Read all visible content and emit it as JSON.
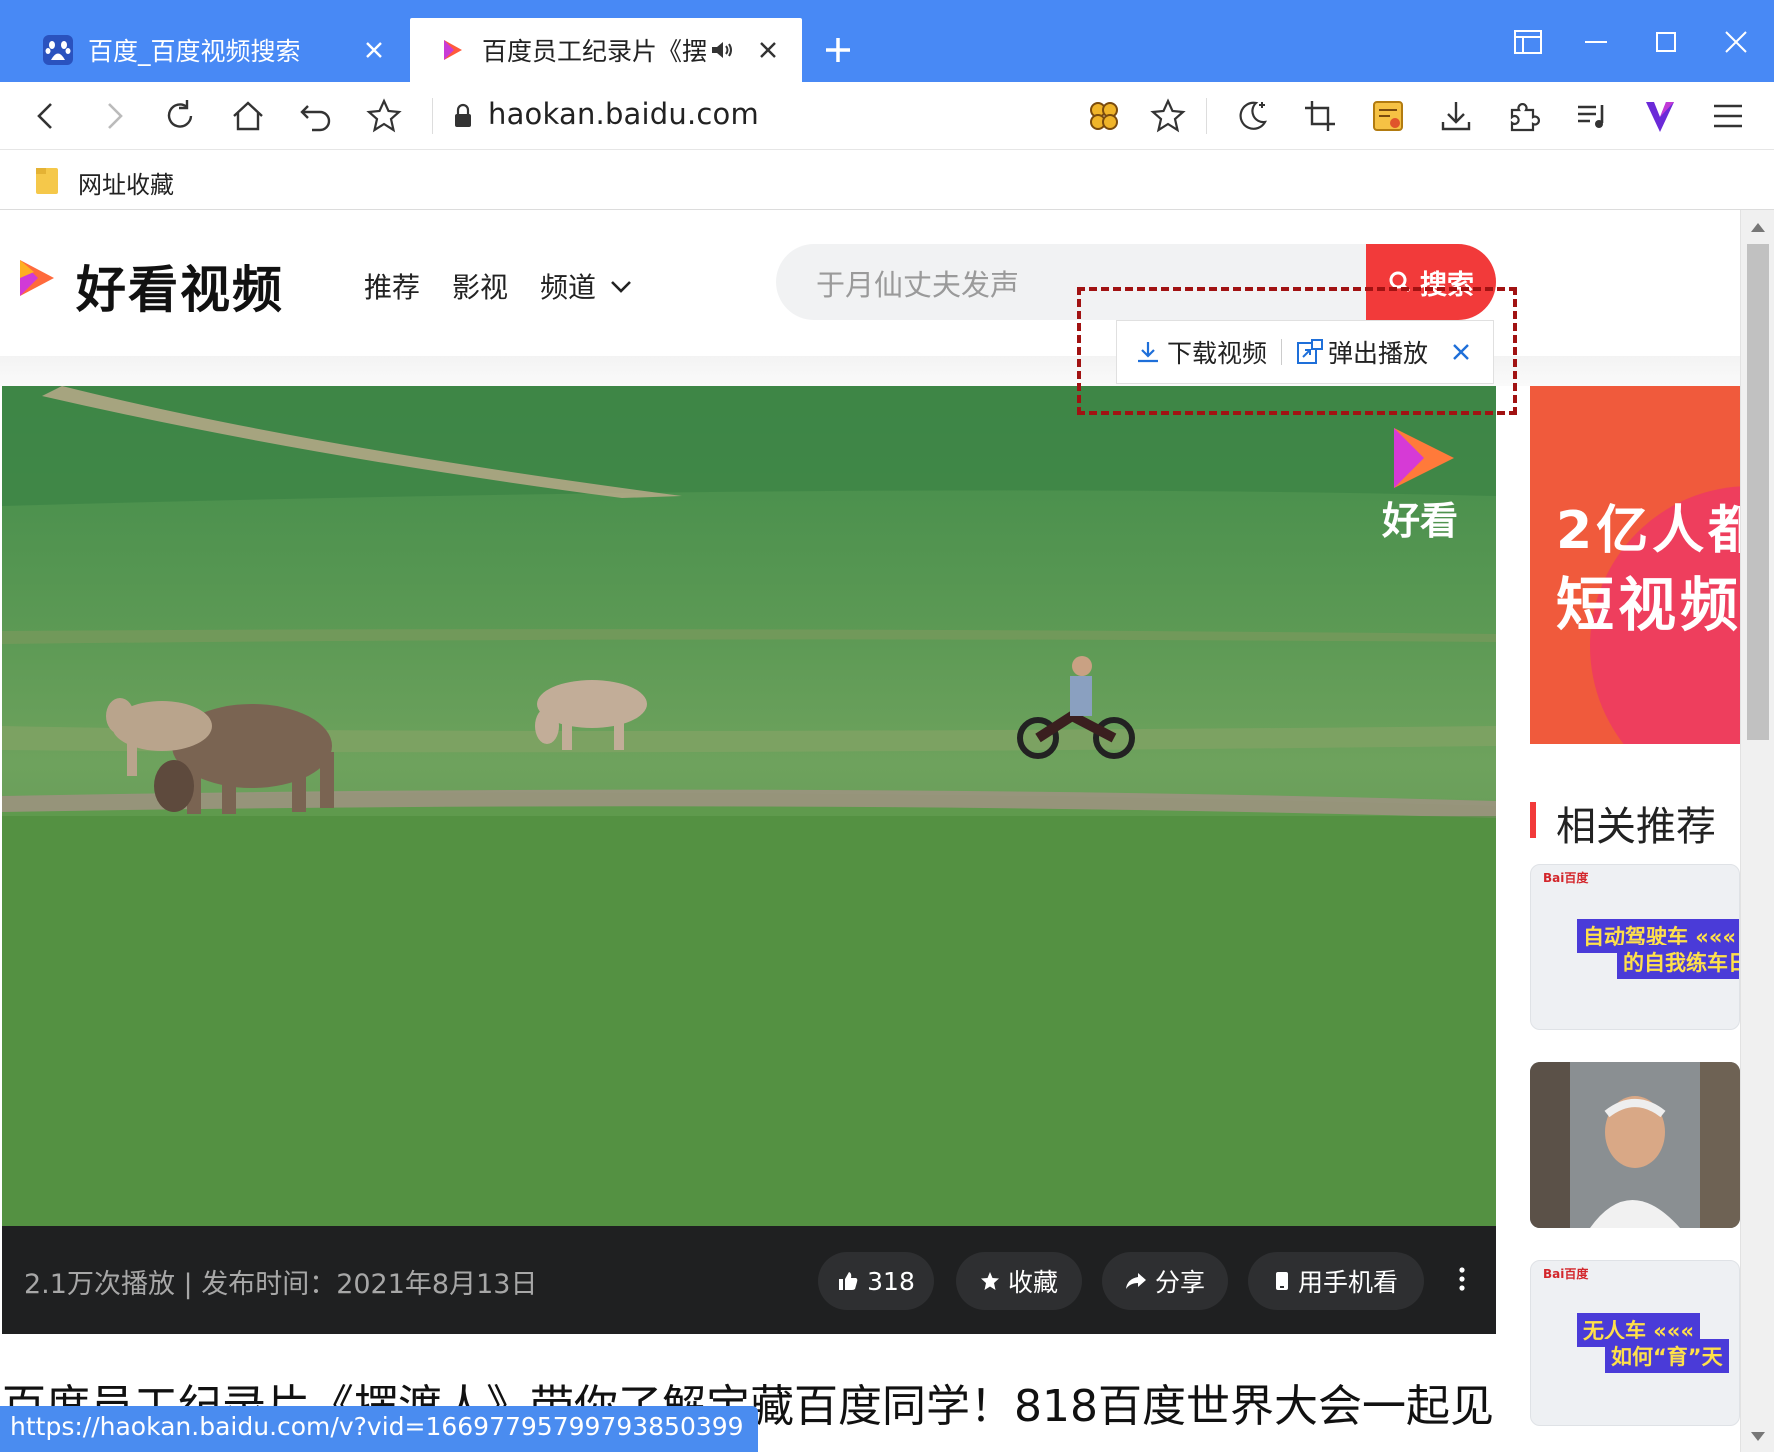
{
  "browser": {
    "tabs": [
      {
        "title": "百度_百度视频搜索",
        "active": false
      },
      {
        "title": "百度员工纪录片《摆",
        "active": true
      }
    ],
    "address": "haokan.baidu.com",
    "bookmarks": [
      {
        "label": "网址收藏"
      }
    ],
    "status_url": "https://haokan.baidu.com/v?vid=16697795799793850399"
  },
  "site": {
    "logo_text": "好看视频",
    "nav": [
      "推荐",
      "影视",
      "频道"
    ],
    "search": {
      "placeholder": "于月仙丈夫发声",
      "button": "搜索"
    }
  },
  "video_popover": {
    "download": "下载视频",
    "popup": "弹出播放"
  },
  "video": {
    "watermark": "好看",
    "views": "2.1万次播放 | 发布时间：2021年8月13日",
    "likes": "318",
    "favorite": "收藏",
    "share": "分享",
    "mobile": "用手机看",
    "title": "百度员工纪录片《摆渡人》带你了解宝藏百度同学！818百度世界大会一起见"
  },
  "sidebar": {
    "ad_line1": "2亿人都",
    "ad_line2": "短视频",
    "related_title": "相关推荐",
    "thumb_labels": [
      "自动驾驶车 «««",
      "的自我练车日",
      "无人车 «««",
      "如何“育”天"
    ]
  },
  "colors": {
    "tab_bar": "#4889f5",
    "accent_red": "#f23a3a",
    "link_blue": "#1e6fd9"
  }
}
